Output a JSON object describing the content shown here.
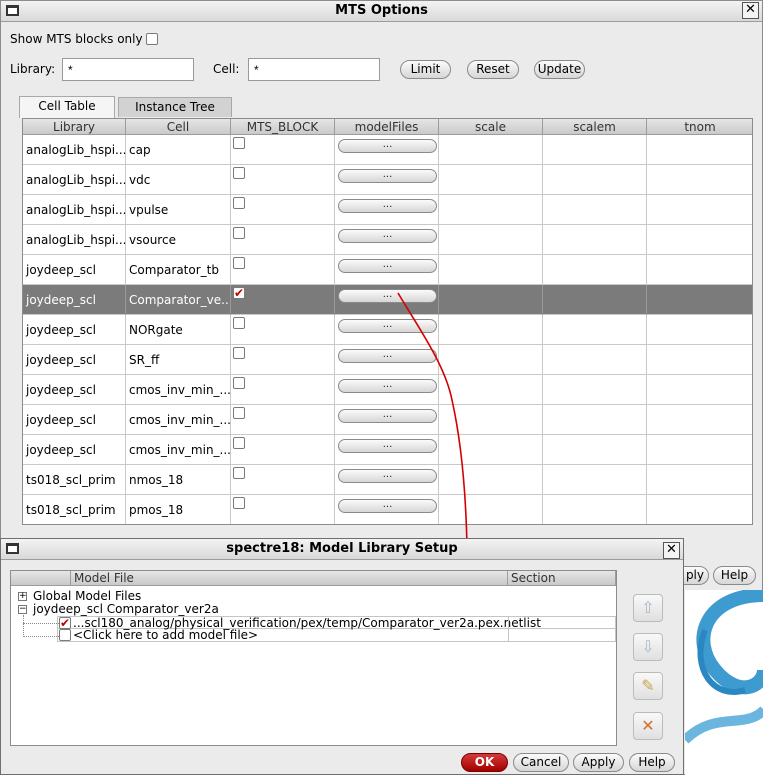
{
  "mts_window": {
    "title": "MTS Options",
    "close_glyph": "✕",
    "show_blocks_label": "Show MTS blocks only",
    "show_blocks_checked": false,
    "library_label": "Library:",
    "library_value": "*",
    "cell_label": "Cell:",
    "cell_value": "*",
    "buttons": {
      "limit": "Limit",
      "reset": "Reset",
      "update": "Update"
    },
    "tabs": {
      "cell_table": "Cell Table",
      "instance_tree": "Instance Tree"
    },
    "columns": [
      "Library",
      "Cell",
      "MTS_BLOCK",
      "modelFiles",
      "scale",
      "scalem",
      "tnom"
    ],
    "rows": [
      {
        "library": "analogLib_hspi...",
        "cell": "cap",
        "mts_block": false,
        "model_files": "...",
        "selected": false
      },
      {
        "library": "analogLib_hspi...",
        "cell": "vdc",
        "mts_block": false,
        "model_files": "...",
        "selected": false
      },
      {
        "library": "analogLib_hspi...",
        "cell": "vpulse",
        "mts_block": false,
        "model_files": "...",
        "selected": false
      },
      {
        "library": "analogLib_hspi...",
        "cell": "vsource",
        "mts_block": false,
        "model_files": "...",
        "selected": false
      },
      {
        "library": "joydeep_scl",
        "cell": "Comparator_tb",
        "mts_block": false,
        "model_files": "...",
        "selected": false
      },
      {
        "library": "joydeep_scl",
        "cell": "Comparator_ve...",
        "mts_block": true,
        "model_files": "...",
        "selected": true
      },
      {
        "library": "joydeep_scl",
        "cell": "NORgate",
        "mts_block": false,
        "model_files": "...",
        "selected": false
      },
      {
        "library": "joydeep_scl",
        "cell": "SR_ff",
        "mts_block": false,
        "model_files": "...",
        "selected": false
      },
      {
        "library": "joydeep_scl",
        "cell": "cmos_inv_min_...",
        "mts_block": false,
        "model_files": "...",
        "selected": false
      },
      {
        "library": "joydeep_scl",
        "cell": "cmos_inv_min_...",
        "mts_block": false,
        "model_files": "...",
        "selected": false
      },
      {
        "library": "joydeep_scl",
        "cell": "cmos_inv_min_...",
        "mts_block": false,
        "model_files": "...",
        "selected": false
      },
      {
        "library": "ts018_scl_prim",
        "cell": "nmos_18",
        "mts_block": false,
        "model_files": "...",
        "selected": false
      },
      {
        "library": "ts018_scl_prim",
        "cell": "pmos_18",
        "mts_block": false,
        "model_files": "...",
        "selected": false
      }
    ],
    "partial_buttons": {
      "apply_partial": "ply",
      "help": "Help"
    }
  },
  "dialog": {
    "title": "spectre18: Model Library Setup",
    "close_glyph": "✕",
    "columns": {
      "model_file": "Model File",
      "section": "Section"
    },
    "tree": {
      "global": "Global Model Files",
      "cell_node": "joydeep_scl Comparator_ver2a",
      "model_file_path": "...scl180_analog/physical_verification/pex/temp/Comparator_ver2a.pex.netlist",
      "model_file_checked": true,
      "add_placeholder": "<Click here to add model file>"
    },
    "side_icons": [
      "arrow-up-icon",
      "arrow-down-icon",
      "edit-icon",
      "delete-icon"
    ],
    "buttons": {
      "ok": "OK",
      "cancel": "Cancel",
      "apply": "Apply",
      "help": "Help"
    }
  },
  "colors": {
    "selected_row": "#7b7b7b",
    "ok_button": "#b30000",
    "annotation_line": "#d40000"
  }
}
